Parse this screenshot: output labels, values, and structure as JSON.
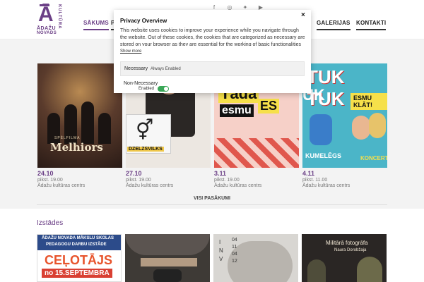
{
  "logo": {
    "letter": "Ā",
    "vertical": "KULTŪRA",
    "line1": "ĀDAŽU",
    "line2": "NOVADS"
  },
  "social": {
    "facebook": "f",
    "instagram": "◎",
    "twitter": "✦",
    "youtube": "▶"
  },
  "nav": {
    "home": "SĀKUMS",
    "partial": "P",
    "galleries": "GALERIJAS",
    "contacts": "KONTAKTI"
  },
  "events": [
    {
      "date": "24.10",
      "time": "pikst. 19.00",
      "venue": "Ādažu kultūras centrs",
      "poster_title": "Melhiors",
      "poster_sub": "SPĒLFILMA"
    },
    {
      "date": "27.10",
      "time": "pikst. 19.00",
      "venue": "Ādažu kultūras centrs",
      "poster_title": "DZELZSVILKS",
      "poster_symbol": "⚥"
    },
    {
      "date": "3.11",
      "time": "pikst. 19.00",
      "venue": "Ādažu kultūras centrs",
      "poster_title_1": "Tāda",
      "poster_title_2": "ES",
      "poster_title_3": "esmu"
    },
    {
      "date": "4.11",
      "time": "pikst. 11.00",
      "venue": "Ādažu kultūras centrs",
      "poster_title_1": "TUK TUK",
      "poster_title_2": "UK",
      "poster_badge": "ESMU KLĀT!",
      "poster_foot": "KUMELĒGS",
      "poster_concert": "KONCERT"
    }
  ],
  "all_events_link": "VISI PASĀKUMI",
  "exhibitions": {
    "title": "Izstādes",
    "items": [
      {
        "bar_1": "ĀDAŽU NOVADA MĀKSLU SKOLAS",
        "bar_2": "PEDAGOGU DARBU IZSTĀDE",
        "big": "CEĻOTĀJS",
        "date": "no 15.SEPTEMBRA"
      },
      {},
      {
        "numbers": [
          "04",
          "11",
          "04",
          "12"
        ],
        "letters": [
          "I",
          "N",
          "V"
        ]
      },
      {
        "t1": "Militārā fotogrāfa",
        "t2": "Naura Dorobžaja"
      }
    ]
  },
  "cookie": {
    "title": "Privacy Overview",
    "close": "×",
    "text": "This website uses cookies to improve your experience while you navigate through the website. Out of these cookies, the cookies that are categorized as necessary are stored on your browser as they are essential for the working of basic functionalities of the",
    "show_more": "Show more",
    "necessary_label": "Necessary",
    "necessary_status": "Always Enabled",
    "nonnecessary_label": "Non-Necessary",
    "nonnecessary_status": "Enabled",
    "toggle_on": true
  },
  "colors": {
    "brand": "#6b3f86",
    "toggle": "#3aa757"
  }
}
